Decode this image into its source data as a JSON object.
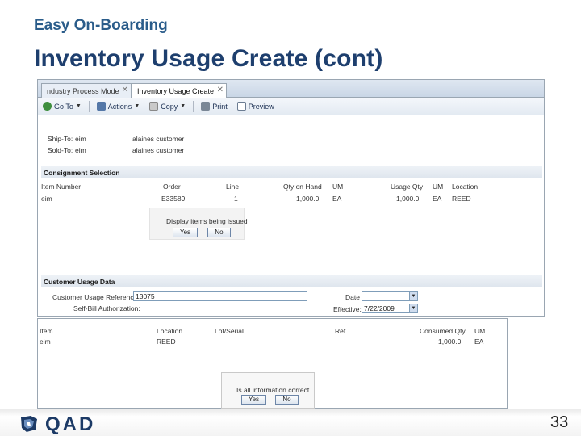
{
  "slide": {
    "kicker": "Easy On-Boarding",
    "title": "Inventory Usage Create (cont)",
    "page_number": "33",
    "logo_text": "QAD"
  },
  "app": {
    "tabs": [
      {
        "label": "ndustry Process Mode",
        "close": "✕"
      },
      {
        "label": "Inventory Usage Create",
        "close": "✕"
      }
    ],
    "toolbar": {
      "goto": "Go To",
      "actions": "Actions",
      "copy": "Copy",
      "print": "Print",
      "preview": "Preview"
    },
    "ship_to": {
      "label": "Ship-To:",
      "code": "eim",
      "name": "alaines customer"
    },
    "sold_to": {
      "label": "Sold-To:",
      "code": "eim",
      "name": "alaines customer"
    },
    "consignment": {
      "title": "Consignment Selection",
      "headers": [
        "Item Number",
        "Order",
        "Line",
        "Qty on Hand",
        "UM",
        "Usage Qty",
        "UM",
        "Location"
      ],
      "row": [
        "eim",
        "E33589",
        "1",
        "1,000.0",
        "EA",
        "1,000.0",
        "EA",
        "REED"
      ]
    },
    "popup": {
      "question": "Display items being issued",
      "yes": "Yes",
      "no": "No"
    },
    "usage": {
      "title": "Customer Usage Data",
      "reference_label": "Customer Usage Reference:",
      "reference_value": "13075",
      "self_bill_label": "Self-Bill Authorization:",
      "date_label": "Date",
      "date_value": "",
      "effective_label": "Effective:",
      "effective_value": "7/22/2009"
    }
  },
  "grid2": {
    "headers": [
      "Item",
      "Location",
      "Lot/Serial",
      "Ref",
      "Consumed Qty",
      "UM"
    ],
    "row": [
      "eim",
      "REED",
      "",
      "",
      "1,000.0",
      "EA"
    ]
  },
  "confirm": {
    "question": "Is all information correct",
    "yes": "Yes",
    "no": "No"
  }
}
